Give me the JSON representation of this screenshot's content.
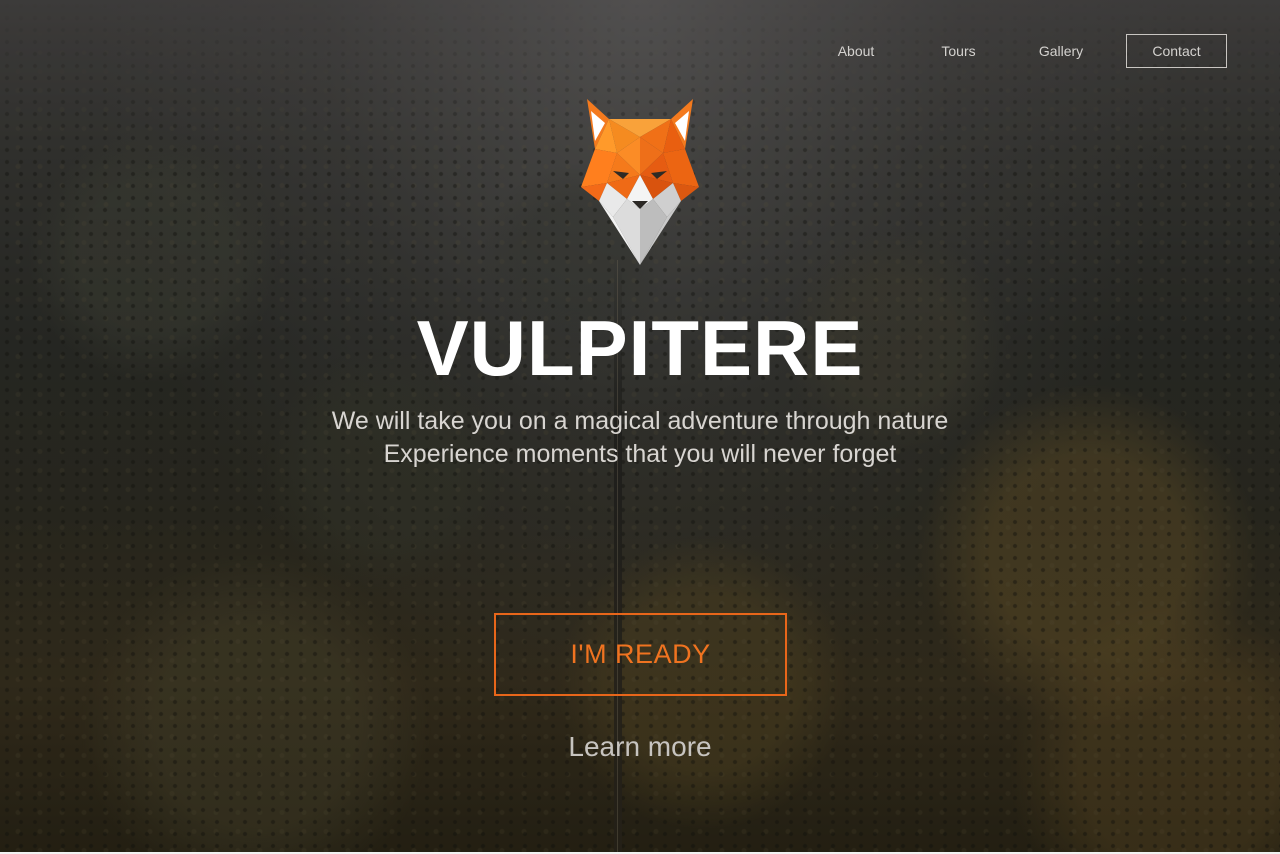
{
  "nav": {
    "items": [
      {
        "label": "About"
      },
      {
        "label": "Tours"
      },
      {
        "label": "Gallery"
      },
      {
        "label": "Contact"
      }
    ]
  },
  "hero": {
    "logo_icon": "fox-head-icon",
    "title": "VULPITERE",
    "tagline_line1": "We will take you on a magical adventure through nature",
    "tagline_line2": "Experience moments that you will never forget",
    "cta_label": "I'M READY",
    "learn_more_label": "Learn more"
  },
  "colors": {
    "accent": "#e8661a",
    "title": "#ffffff",
    "text": "#d8d5d1"
  }
}
